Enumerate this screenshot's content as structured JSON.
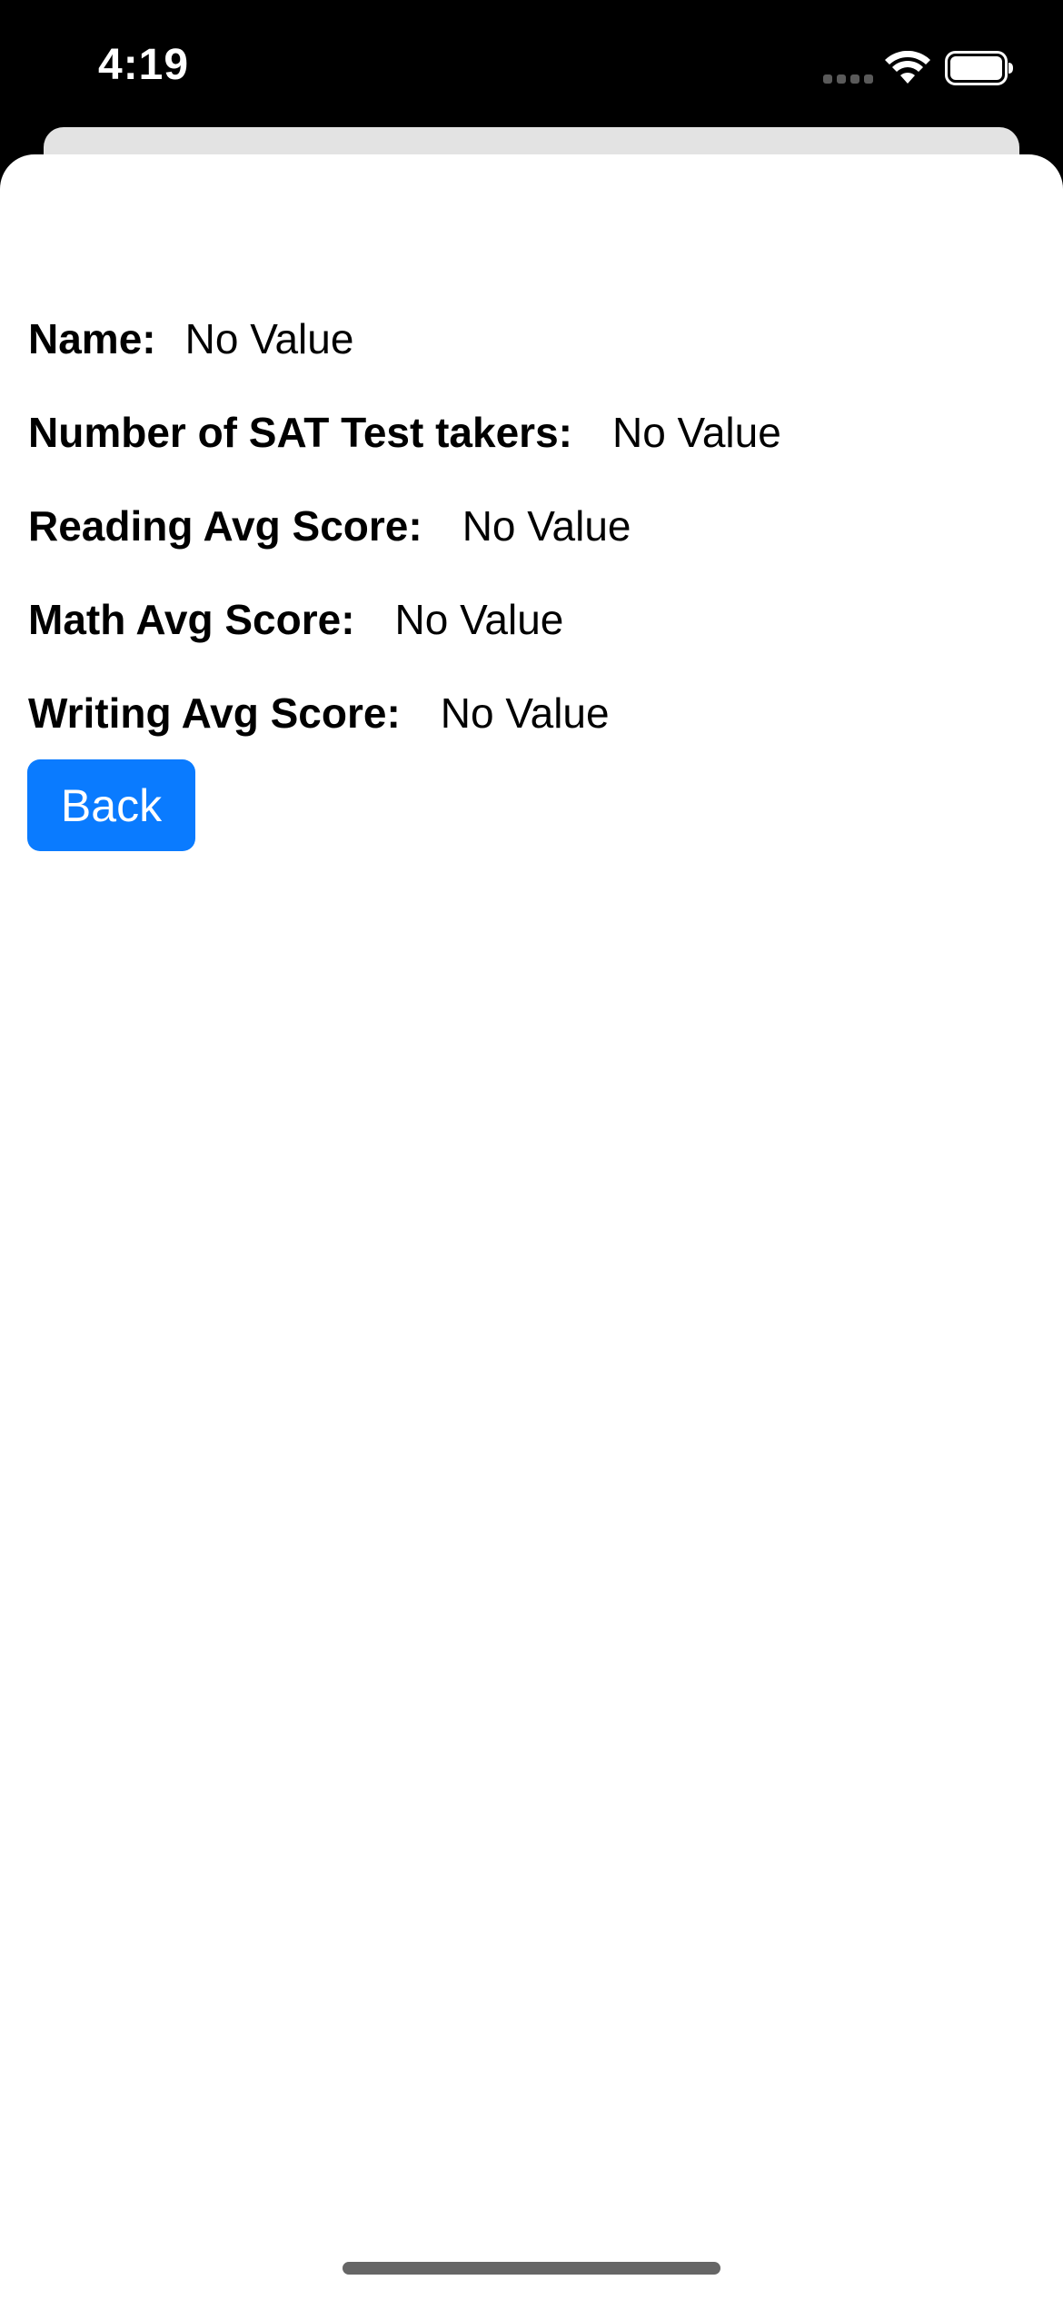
{
  "status_bar": {
    "time": "4:19",
    "icons": [
      "signal-icon",
      "wifi-icon",
      "battery-icon"
    ]
  },
  "details": {
    "name": {
      "label": "Name:",
      "value": "No Value"
    },
    "test_takers": {
      "label": "Number of SAT Test takers:",
      "value": "No Value"
    },
    "reading": {
      "label": "Reading Avg Score:",
      "value": "No Value"
    },
    "math": {
      "label": "Math Avg Score:",
      "value": "No Value"
    },
    "writing": {
      "label": "Writing Avg Score:",
      "value": "No Value"
    }
  },
  "actions": {
    "back_label": "Back"
  },
  "colors": {
    "accent": "#0a7bff",
    "sheet_background": "#ffffff",
    "status_background": "#000000"
  }
}
